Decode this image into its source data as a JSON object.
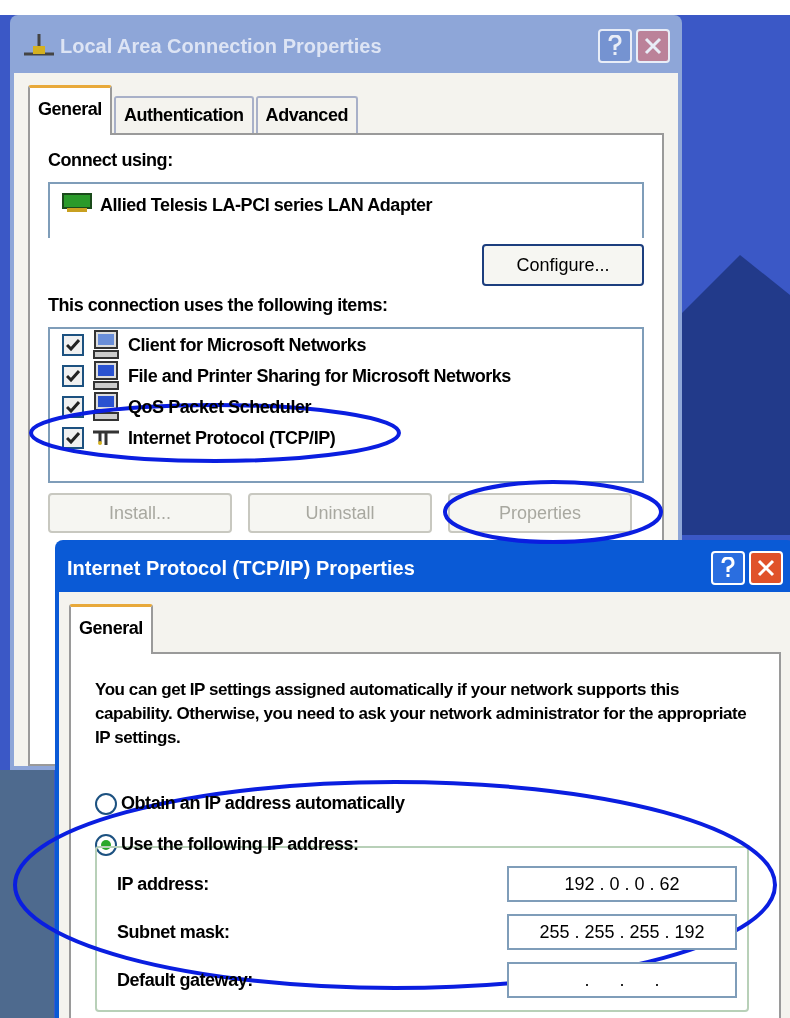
{
  "background_window": {
    "title": "Local Area Connection Properties",
    "tabs": [
      {
        "label": "General",
        "selected": true
      },
      {
        "label": "Authentication",
        "selected": false
      },
      {
        "label": "Advanced",
        "selected": false
      }
    ],
    "connect_using_label": "Connect using:",
    "adapter": "Allied Telesis LA-PCI series LAN Adapter",
    "configure_button": "Configure...",
    "items_label": "This connection uses the following items:",
    "items": [
      {
        "label": "Client for Microsoft Networks",
        "kind": "client",
        "checked": true
      },
      {
        "label": "File and Printer Sharing for Microsoft Networks",
        "kind": "service",
        "checked": true
      },
      {
        "label": "QoS Packet Scheduler",
        "kind": "service",
        "checked": true
      },
      {
        "label": "Internet Protocol (TCP/IP)",
        "kind": "protocol",
        "checked": true
      }
    ],
    "buttons": [
      {
        "label": "Install...",
        "disabled": true
      },
      {
        "label": "Uninstall",
        "disabled": true
      },
      {
        "label": "Properties",
        "disabled": true
      }
    ]
  },
  "front_window": {
    "title": "Internet Protocol (TCP/IP) Properties",
    "tabs": [
      {
        "label": "General",
        "selected": true
      }
    ],
    "description": "You can get IP settings assigned automatically if your network supports this capability. Otherwise, you need to ask your network administrator for the appropriate IP settings.",
    "options": [
      {
        "label": "Obtain an IP address automatically",
        "selected": false
      },
      {
        "label": "Use the following IP address:",
        "selected": true
      }
    ],
    "fields": [
      {
        "label": "IP address:",
        "value": "192 . 0 . 0 . 62"
      },
      {
        "label": "Subnet mask:",
        "value": "255 . 255 . 255 . 192"
      },
      {
        "label": "Default gateway:",
        "value": ".      .      ."
      }
    ]
  }
}
